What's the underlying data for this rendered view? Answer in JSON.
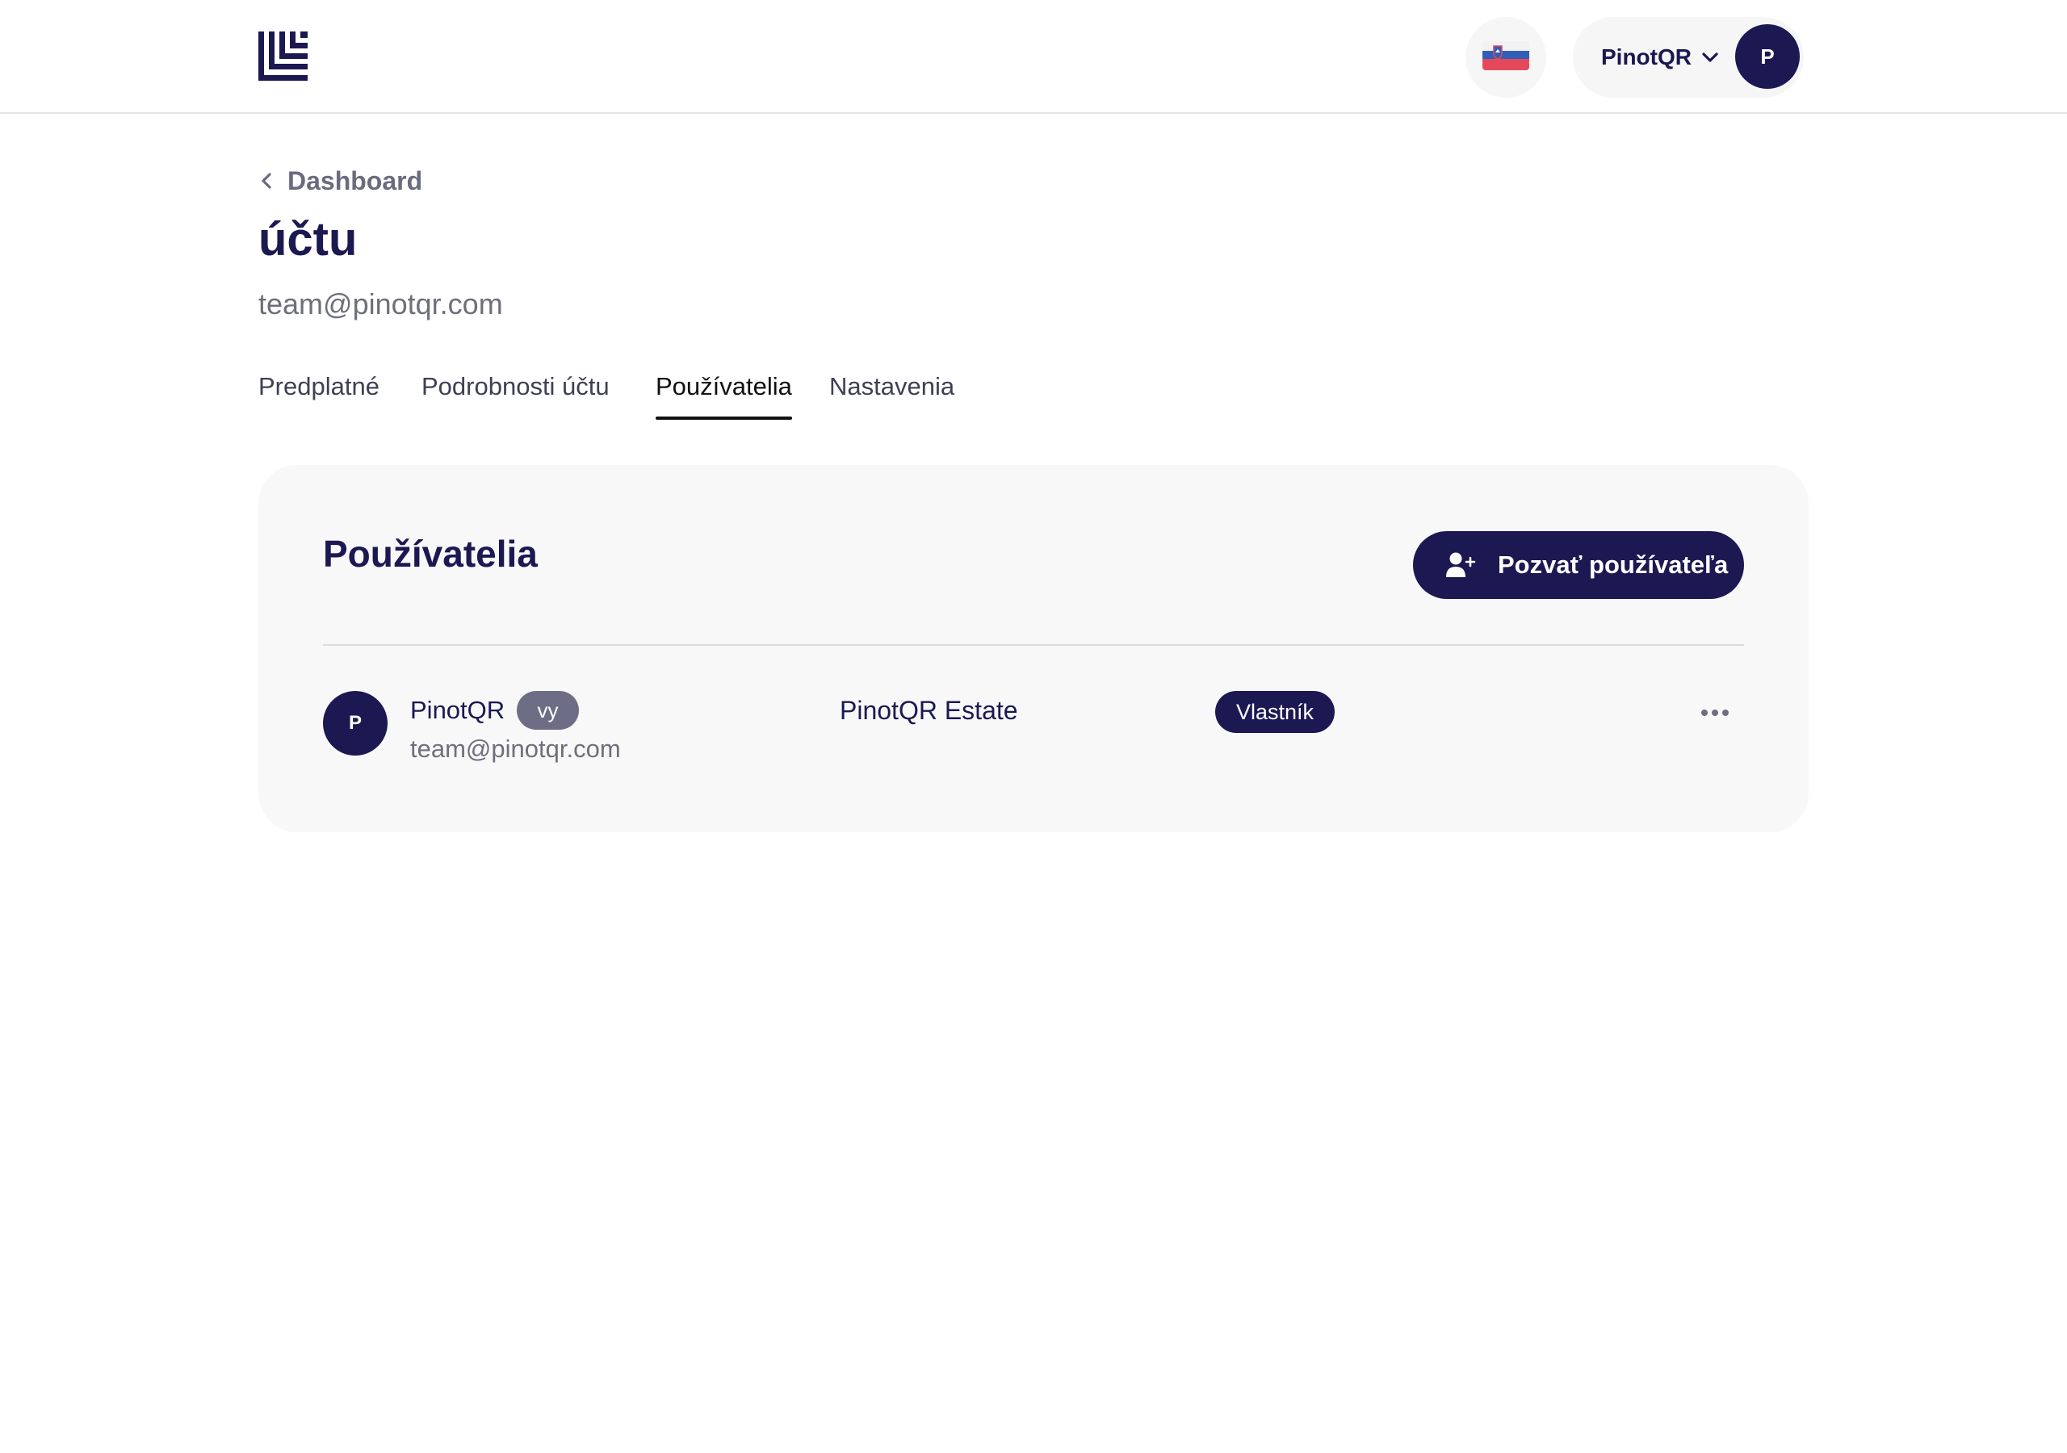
{
  "header": {
    "logo": "brand-logo",
    "language": {
      "icon": "slovenia-flag-icon"
    },
    "account": {
      "name": "PinotQR",
      "avatar_initial": "P"
    }
  },
  "page": {
    "back_label": "Dashboard",
    "title": "účtu",
    "subtitle": "team@pinotqr.com"
  },
  "tabs": [
    {
      "label": "Predplatné",
      "active": false
    },
    {
      "label": "Podrobnosti účtu",
      "active": false
    },
    {
      "label": "Používatelia",
      "active": true
    },
    {
      "label": "Nastavenia",
      "active": false
    }
  ],
  "users_card": {
    "title": "Používatelia",
    "invite_label": "Pozvať používateľa",
    "rows": [
      {
        "avatar_initial": "P",
        "name": "PinotQR",
        "you_badge": "vy",
        "email": "team@pinotqr.com",
        "organization": "PinotQR Estate",
        "role": "Vlastník"
      }
    ]
  },
  "colors": {
    "brand": "#1b1852",
    "card_background": "#f8f8f9",
    "muted_text": "#6e6f7c",
    "you_badge": "#6e6d86"
  }
}
